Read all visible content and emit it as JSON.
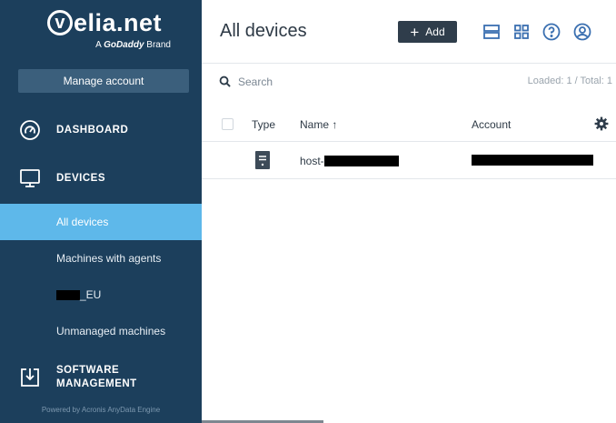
{
  "sidebar": {
    "brand": {
      "logo_letter": "v",
      "name": "elia.net",
      "tagline_prefix": "A ",
      "tagline_brand": "GoDaddy",
      "tagline_suffix": " Brand"
    },
    "manage_account_label": "Manage account",
    "sections": [
      {
        "label": "DASHBOARD",
        "icon": "dashboard-gauge-icon"
      },
      {
        "label": "DEVICES",
        "icon": "monitor-icon"
      },
      {
        "label": "SOFTWARE\nMANAGEMENT",
        "icon": "software-download-icon"
      }
    ],
    "device_items": [
      {
        "label": "All devices",
        "active": true
      },
      {
        "label": "Machines with agents",
        "active": false
      },
      {
        "label": "_EU",
        "active": false,
        "redacted_prefix": true
      },
      {
        "label": "Unmanaged machines",
        "active": false
      }
    ],
    "powered_by": "Powered by Acronis AnyData Engine"
  },
  "header": {
    "title": "All devices",
    "add_label": "Add",
    "icons": [
      "list-view-icon",
      "grid-view-icon",
      "help-icon",
      "account-icon"
    ]
  },
  "search": {
    "placeholder": "Search",
    "value": "",
    "loaded_text": "Loaded: 1 / Total: 1"
  },
  "table": {
    "columns": {
      "type": "Type",
      "name": "Name ↑",
      "account": "Account"
    },
    "rows": [
      {
        "type_icon": "server-icon",
        "name_prefix": "host-",
        "name_redacted": true,
        "account_redacted": true
      }
    ]
  },
  "colors": {
    "sidebar_bg": "#1c3f5c",
    "active_item": "#5eb8ea",
    "accent_icon": "#3a6fb0",
    "add_button_bg": "#2f3d4b"
  }
}
